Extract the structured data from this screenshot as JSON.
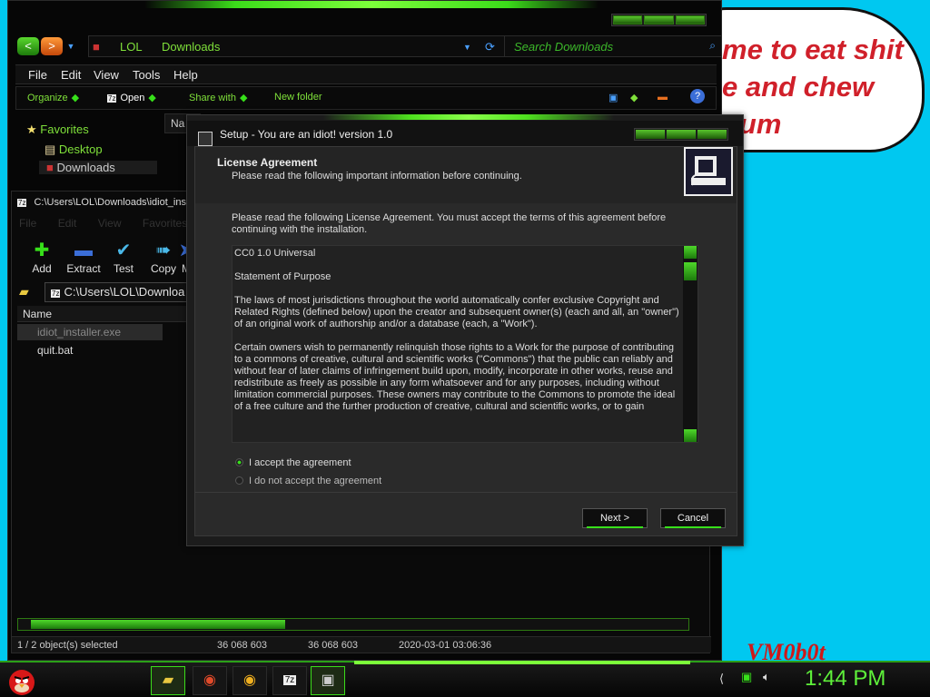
{
  "desktop": {
    "bubble_text": "me to eat shit\ne and chew\ngum",
    "watermark": "VM0b0t"
  },
  "explorer": {
    "nav": {
      "back": "<",
      "forward": ">",
      "path": [
        "LOL",
        "Downloads"
      ],
      "search_placeholder": "Search Downloads"
    },
    "menu": [
      "File",
      "Edit",
      "View",
      "Tools",
      "Help"
    ],
    "toolbar": [
      "Organize",
      "Open",
      "Share with",
      "New folder"
    ],
    "navpane": [
      "Favorites",
      "Desktop",
      "Downloads"
    ],
    "name_tab": "Na"
  },
  "zip": {
    "title": "C:\\Users\\LOL\\Downloads\\idiot_ins",
    "menu": [
      "File",
      "Edit",
      "View",
      "Favorites"
    ],
    "tools": [
      {
        "label": "Add",
        "icon": "plus-icon"
      },
      {
        "label": "Extract",
        "icon": "minus-icon"
      },
      {
        "label": "Test",
        "icon": "check-icon"
      },
      {
        "label": "Copy",
        "icon": "copy-arrow-icon"
      },
      {
        "label": "M",
        "icon": "move-icon"
      }
    ],
    "path": "C:\\Users\\LOL\\Downloa",
    "column_name": "Name",
    "files": [
      {
        "name": "idiot_installer.exe",
        "selected": true
      },
      {
        "name": "quit.bat",
        "selected": false
      }
    ],
    "status": {
      "selection": "1 / 2 object(s) selected",
      "size": "36 068 603",
      "packed": "36 068 603",
      "modified": "2020-03-01 03:06:36"
    }
  },
  "dialog": {
    "title": "Setup - You are an idiot! version 1.0",
    "heading": "License Agreement",
    "subheading": "Please read the following important information before continuing.",
    "instruction": "Please read the following License Agreement. You must accept the terms of this agreement before continuing with the installation.",
    "license_paragraphs": [
      "CC0 1.0 Universal",
      "Statement of Purpose",
      "The laws of most jurisdictions throughout the world automatically confer exclusive Copyright and Related Rights (defined below) upon the creator and subsequent owner(s) (each and all, an \"owner\") of an original work of authorship and/or a database (each, a \"Work\").",
      "Certain owners wish to permanently relinquish those rights to a Work for the purpose of contributing to a commons of creative, cultural and scientific works (\"Commons\") that the public can reliably and without fear of later claims of infringement build upon, modify, incorporate in other works, reuse and redistribute as freely as possible in any form whatsoever and for any purposes, including without limitation commercial purposes. These owners may contribute to the Commons to promote the ideal of a free culture and the further production of creative, cultural and scientific works, or to gain"
    ],
    "accept_label": "I accept the agreement",
    "decline_label": "I do not accept the agreement",
    "accept_selected": true,
    "next_label": "Next >",
    "cancel_label": "Cancel"
  },
  "taskbar": {
    "clock": "1:44 PM",
    "items": [
      "folder-icon",
      "chrome-icon",
      "chrome-canary-icon",
      "7zip-icon",
      "setup-icon"
    ]
  },
  "colors": {
    "accent": "#37e01a",
    "desktop": "#00c8f0",
    "bubble_text": "#d0202a"
  }
}
